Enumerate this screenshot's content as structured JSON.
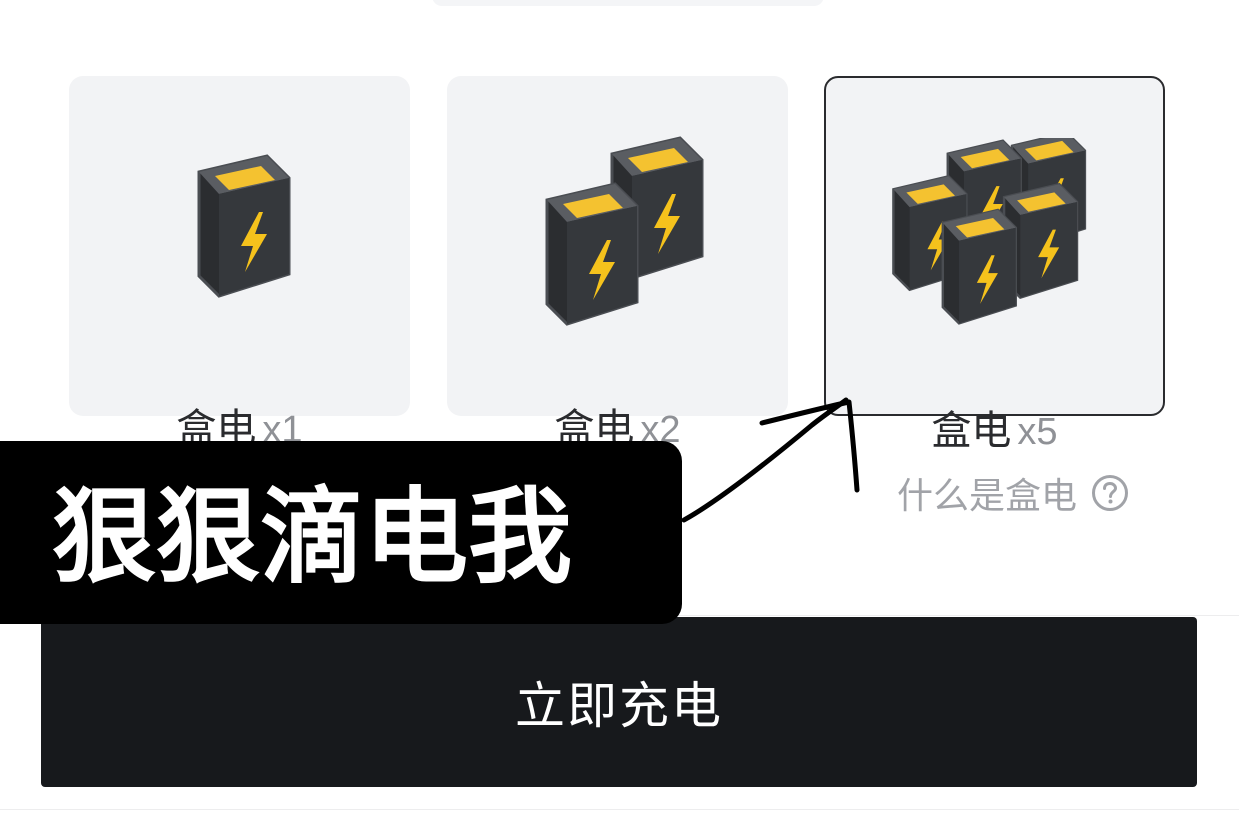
{
  "packages": [
    {
      "name": "盒电",
      "qty": "x1",
      "count": 1,
      "selected": false
    },
    {
      "name": "盒电",
      "qty": "x2",
      "count": 2,
      "selected": false
    },
    {
      "name": "盒电",
      "qty": "x5",
      "count": 5,
      "selected": true
    }
  ],
  "help": {
    "label": "什么是盒电",
    "icon": "question-circle-icon"
  },
  "primary_button": {
    "label": "立即充电"
  },
  "overlay": {
    "caption": "狠狠滴电我",
    "arrow_icon": "hand-drawn-arrow-icon"
  },
  "colors": {
    "button_bg": "#17191c",
    "card_bg": "#f2f3f5",
    "battery_body": "#2b2d30",
    "battery_top": "#f4c230",
    "bolt": "#f5c21c"
  }
}
